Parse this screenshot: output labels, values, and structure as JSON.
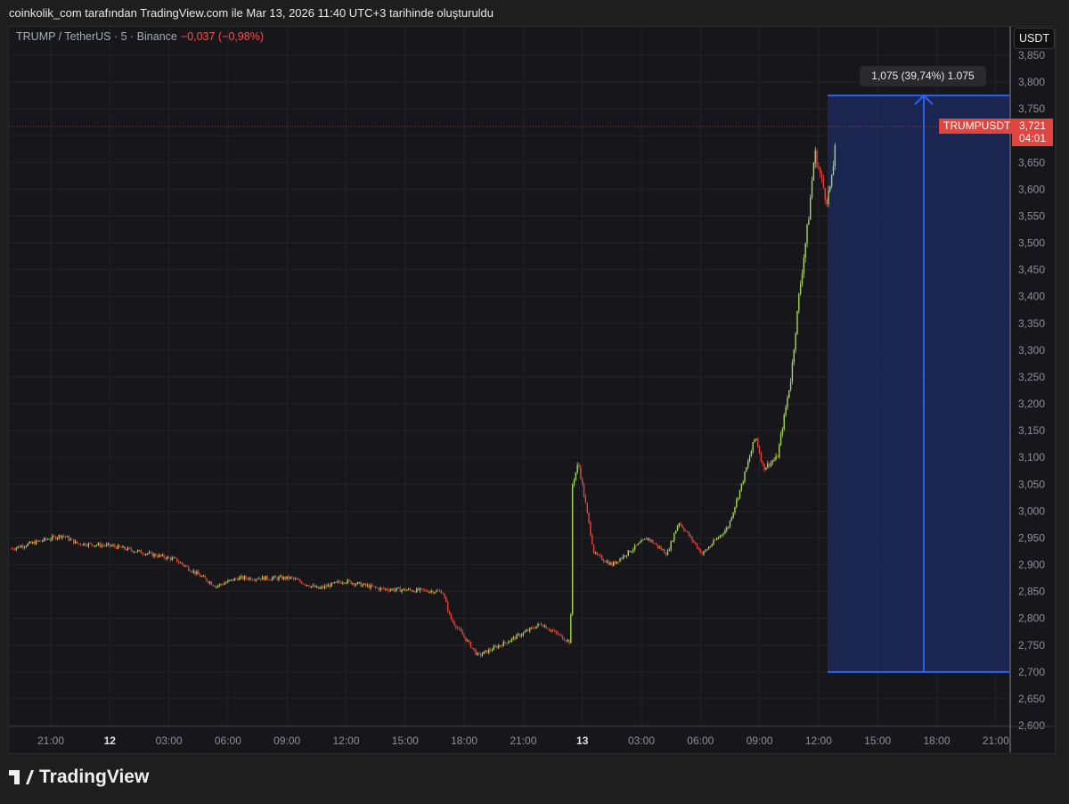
{
  "caption": "coinkolik_com tarafından TradingView.com ile Mar 13, 2026 11:40 UTC+3 tarihinde oluşturuldu",
  "legend": {
    "symbol": "TRUMP / TetherUS · 5 · Binance",
    "change": "−0,037 (−0,98%)"
  },
  "currency_button": "USDT",
  "last_price": {
    "symbol": "TRUMPUSDT",
    "price": "3,721",
    "countdown": "04:01",
    "color": "#e0463f"
  },
  "measure": {
    "label": "1,075 (39,74%) 1.075",
    "from": 2.7,
    "to": 3.775
  },
  "brand": "TradingView",
  "chart_data": {
    "type": "candlestick",
    "title": "TRUMP / TetherUS · 5 · Binance",
    "ylim": [
      2.6,
      3.85
    ],
    "y_ticks": [
      "3,850",
      "3,800",
      "3,750",
      "3,700",
      "3,650",
      "3,600",
      "3,550",
      "3,500",
      "3,450",
      "3,400",
      "3,350",
      "3,300",
      "3,250",
      "3,200",
      "3,150",
      "3,100",
      "3,050",
      "3,000",
      "2,950",
      "2,900",
      "2,850",
      "2,800",
      "2,750",
      "2,700",
      "2,650",
      "2,600"
    ],
    "x_ticks": [
      "21:00",
      "12",
      "03:00",
      "06:00",
      "09:00",
      "12:00",
      "15:00",
      "18:00",
      "21:00",
      "13",
      "03:00",
      "06:00",
      "09:00",
      "12:00",
      "15:00",
      "18:00",
      "21:00"
    ],
    "x_tick_hours": [
      21,
      24,
      27,
      30,
      33,
      36,
      39,
      42,
      45,
      48,
      51,
      54,
      57,
      60,
      63,
      66,
      69
    ],
    "path": [
      [
        19,
        2.93
      ],
      [
        21.6,
        2.955
      ],
      [
        22.3,
        2.94
      ],
      [
        24.1,
        2.935
      ],
      [
        27.3,
        2.91
      ],
      [
        29.4,
        2.86
      ],
      [
        30.5,
        2.875
      ],
      [
        33.2,
        2.875
      ],
      [
        34.6,
        2.855
      ],
      [
        35.9,
        2.87
      ],
      [
        37.7,
        2.855
      ],
      [
        40.9,
        2.85
      ],
      [
        41.3,
        2.8
      ],
      [
        42.7,
        2.73
      ],
      [
        44.1,
        2.755
      ],
      [
        45.9,
        2.79
      ],
      [
        47.4,
        2.755
      ],
      [
        47.5,
        3.05
      ],
      [
        47.8,
        3.09
      ],
      [
        48.6,
        2.92
      ],
      [
        49.5,
        2.9
      ],
      [
        51.3,
        2.95
      ],
      [
        52.3,
        2.92
      ],
      [
        52.9,
        2.98
      ],
      [
        54.1,
        2.92
      ],
      [
        55.4,
        2.97
      ],
      [
        56.1,
        3.05
      ],
      [
        56.8,
        3.14
      ],
      [
        57.2,
        3.08
      ],
      [
        57.9,
        3.1
      ],
      [
        58.6,
        3.25
      ],
      [
        59.0,
        3.4
      ],
      [
        59.5,
        3.55
      ],
      [
        59.8,
        3.67
      ],
      [
        60.4,
        3.58
      ],
      [
        60.7,
        3.62
      ],
      [
        60.9,
        3.72
      ]
    ],
    "up_color": "#a5d65a",
    "down_color": "#e0463f"
  }
}
